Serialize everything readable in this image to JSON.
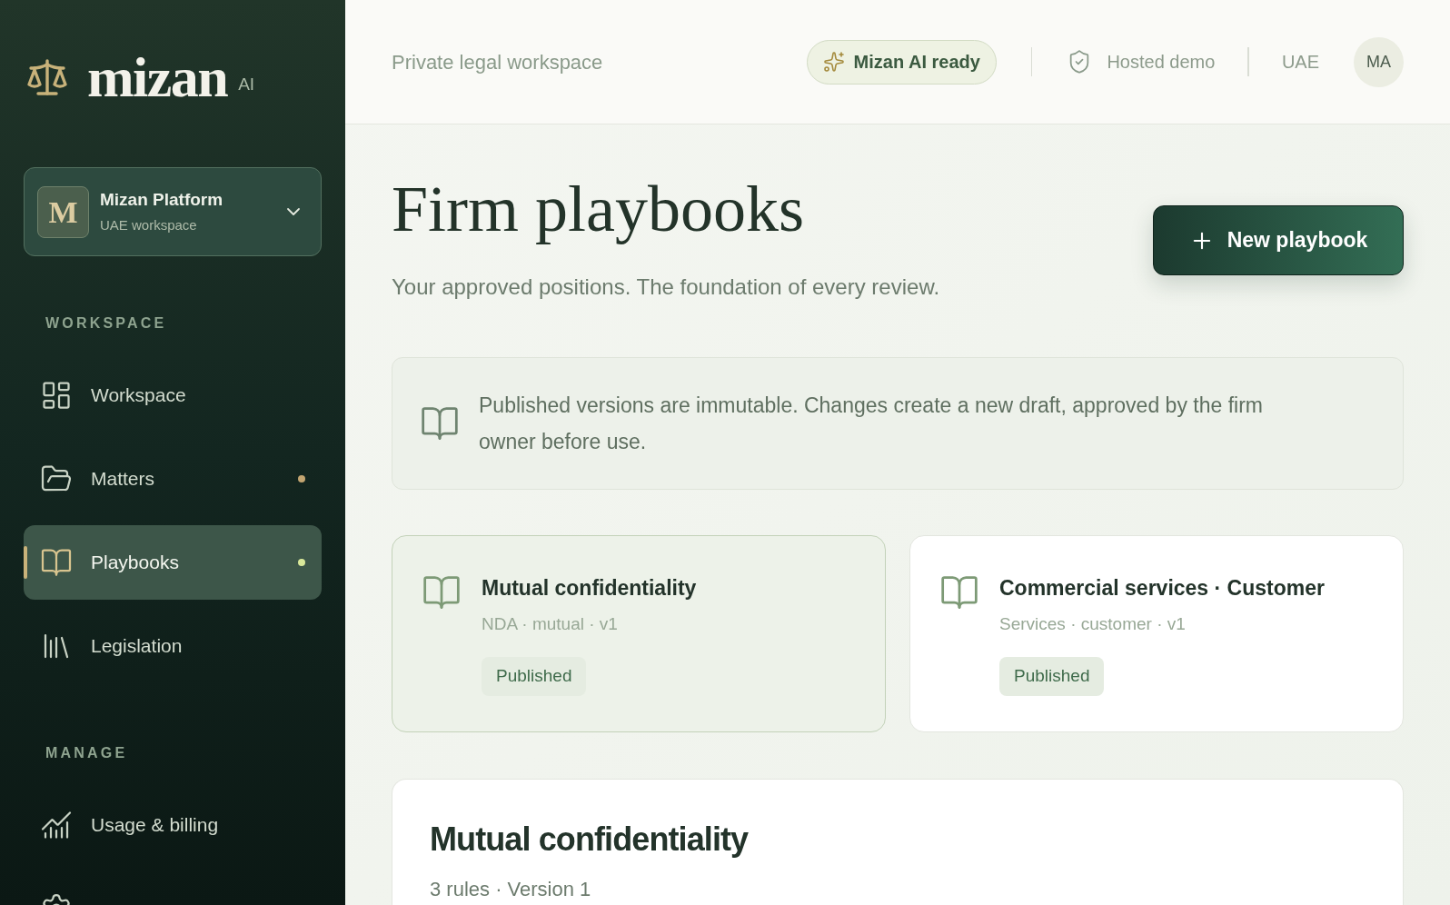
{
  "sidebar": {
    "brand": {
      "name": "mizan",
      "suffix": "AI"
    },
    "workspace_selector": {
      "initial": "M",
      "name": "Mizan Platform",
      "subtitle": "UAE workspace"
    },
    "sections": [
      {
        "label": "WORKSPACE",
        "items": [
          {
            "label": "Workspace",
            "selected": false
          },
          {
            "label": "Matters",
            "selected": false,
            "color": "#c3a571"
          },
          {
            "label": "Playbooks",
            "selected": true,
            "color": "#d9e89a"
          },
          {
            "label": "Legislation",
            "selected": false
          }
        ]
      },
      {
        "label": "MANAGE",
        "items": [
          {
            "label": "Usage & billing",
            "selected": false
          },
          {
            "selected": false
          }
        ]
      }
    ]
  },
  "header": {
    "context": "Private legal workspace",
    "ai_status": "Mizan AI ready",
    "hosting": "Hosted demo",
    "region": "UAE",
    "avatar": "MA"
  },
  "page": {
    "title": "Firm playbooks",
    "subtitle": "Your approved positions. The foundation of every review.",
    "new_button": "New playbook"
  },
  "notice": {
    "text": "Published versions are immutable. Changes create a new draft, approved by the firm owner before use."
  },
  "playbooks": [
    {
      "title": "Mutual confidentiality",
      "meta": "NDA · mutual · v1",
      "status": "Published",
      "selected": true
    },
    {
      "title": "Commercial services · Customer",
      "meta": "Services · customer · v1",
      "status": "Published",
      "selected": false
    }
  ],
  "detail": {
    "title": "Mutual confidentiality",
    "summary": "3 rules · Version 1"
  }
}
